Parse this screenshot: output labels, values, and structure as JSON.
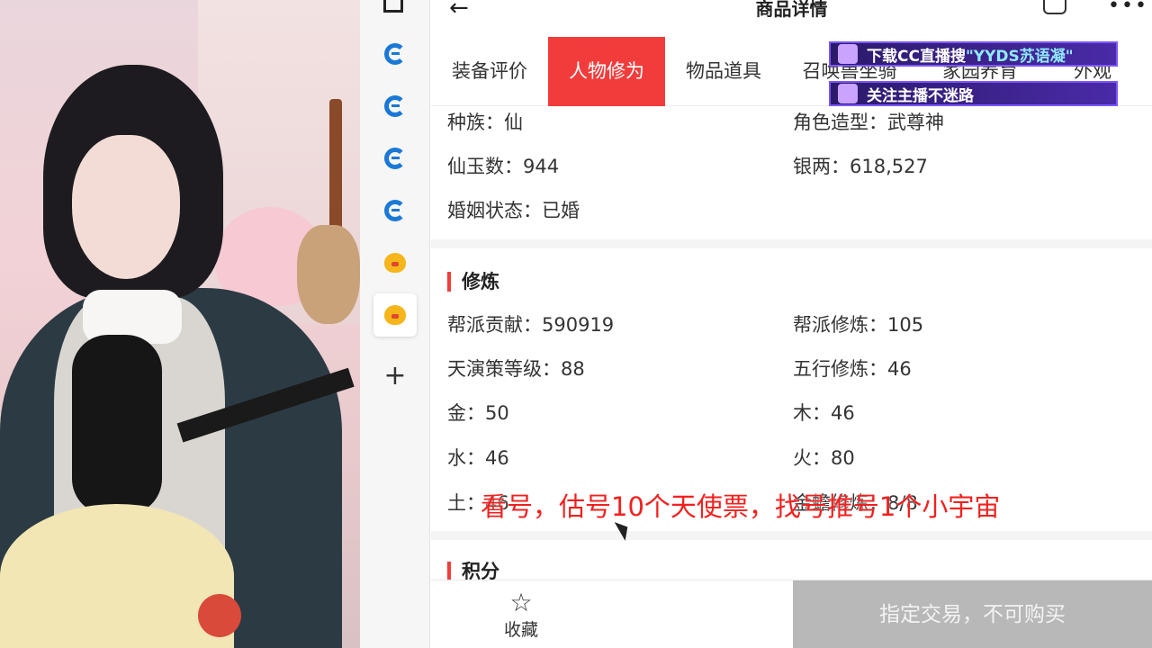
{
  "header": {
    "title": "商品详情"
  },
  "tabs": [
    {
      "label": "装备评价"
    },
    {
      "label": "人物修为"
    },
    {
      "label": "物品道具"
    },
    {
      "label": "召唤兽坐骑"
    },
    {
      "label": "家园养育"
    },
    {
      "label": "外观"
    }
  ],
  "overlay": {
    "banner1_prefix": "下载CC直播搜",
    "banner1_highlight": "\"YYDS苏语凝\"",
    "banner2": "关注主播不迷路",
    "subtitle": "看号，估号10个天使票，找号推号1个小宇宙"
  },
  "basic_info": [
    {
      "label": "种族：",
      "value": "仙"
    },
    {
      "label": "角色造型：",
      "value": "武尊神"
    },
    {
      "label": "仙玉数：",
      "value": "944"
    },
    {
      "label": "银两：",
      "value": "618,527"
    },
    {
      "label": "婚姻状态：",
      "value": "已婚"
    }
  ],
  "cultivation": {
    "title": "修炼",
    "items": [
      {
        "label": "帮派贡献：",
        "value": "590919"
      },
      {
        "label": "帮派修炼：",
        "value": "105"
      },
      {
        "label": "天演策等级：",
        "value": "88"
      },
      {
        "label": "五行修炼：",
        "value": "46"
      },
      {
        "label": "金：",
        "value": "50"
      },
      {
        "label": "木：",
        "value": "46"
      },
      {
        "label": "水：",
        "value": "46"
      },
      {
        "label": "火：",
        "value": "80"
      },
      {
        "label": "土：",
        "value": "46"
      },
      {
        "label": "金蟾修炼：",
        "value": "8/8"
      }
    ]
  },
  "points": {
    "title": "积分"
  },
  "bottom": {
    "favorite_label": "收藏",
    "buy_label": "指定交易，不可购买"
  },
  "colors": {
    "accent": "#f23c3c",
    "disabled": "#b8b8b8"
  },
  "icons": [
    "back-arrow-icon",
    "share-icon",
    "more-icon",
    "edge-icon",
    "chick-app-icon",
    "plus-icon",
    "star-icon",
    "cursor-icon"
  ]
}
